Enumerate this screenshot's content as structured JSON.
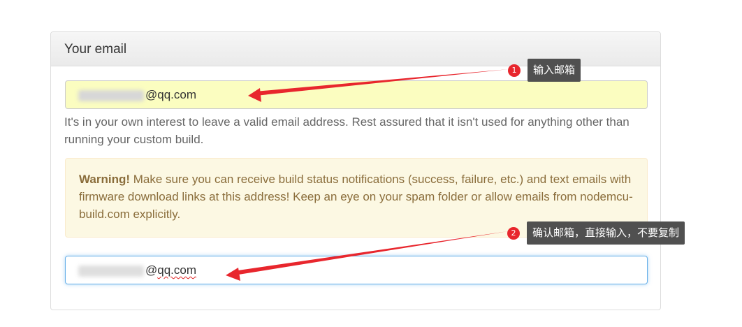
{
  "panel": {
    "title": "Your email",
    "email": {
      "value_suffix": "@qq.com"
    },
    "help_text": "It's in your own interest to leave a valid email address. Rest assured that it isn't used for anything other than running your custom build.",
    "warning": {
      "label": "Warning!",
      "text": " Make sure you can receive build status notifications (success, failure, etc.) and text emails with firmware download links at this address! Keep an eye on your spam folder or allow emails from nodemcu-build.com explicitly."
    },
    "confirm_email": {
      "value_prefix": "@",
      "value_suffix": "qq.com"
    }
  },
  "annotations": [
    {
      "number": "1",
      "text": "输入邮箱"
    },
    {
      "number": "2",
      "text": "确认邮箱，直接输入，不要复制"
    }
  ],
  "colors": {
    "annotation_badge": "#e8262d",
    "annotation_tip_bg": "#505050",
    "arrow": "#e8262d",
    "autofill_bg": "#fbfdc0",
    "warning_bg": "#fcf8e3",
    "focus_border": "#66afe9"
  }
}
